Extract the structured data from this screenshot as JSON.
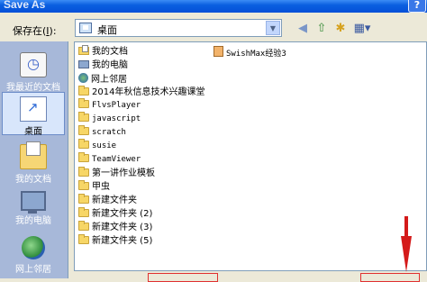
{
  "window": {
    "title": "Save As",
    "help_label": "?"
  },
  "save_in": {
    "label": "保存在(",
    "mnemonic": "I",
    "label_end": "):",
    "value": "桌面"
  },
  "places": [
    {
      "label": "我最近的文档",
      "icon": "recent-documents-icon"
    },
    {
      "label": "桌面",
      "icon": "desktop-icon"
    },
    {
      "label": "我的文档",
      "icon": "my-documents-icon"
    },
    {
      "label": "我的电脑",
      "icon": "my-computer-icon"
    },
    {
      "label": "网上邻居",
      "icon": "network-places-icon"
    }
  ],
  "files": [
    {
      "name": "我的文档",
      "icon": "my-documents-icon"
    },
    {
      "name": "我的电脑",
      "icon": "my-computer-icon"
    },
    {
      "name": "网上邻居",
      "icon": "network-icon"
    },
    {
      "name": "2014年秋信息技术兴趣课堂",
      "icon": "folder-icon"
    },
    {
      "name": "FlvsPlayer",
      "icon": "folder-icon"
    },
    {
      "name": "javascript",
      "icon": "folder-icon"
    },
    {
      "name": "scratch",
      "icon": "folder-icon"
    },
    {
      "name": "susie",
      "icon": "folder-icon"
    },
    {
      "name": "TeamViewer",
      "icon": "folder-icon"
    },
    {
      "name": "第一讲作业模板",
      "icon": "folder-icon"
    },
    {
      "name": "甲虫",
      "icon": "folder-icon"
    },
    {
      "name": "新建文件夹",
      "icon": "folder-icon"
    },
    {
      "name": "新建文件夹 (2)",
      "icon": "folder-icon"
    },
    {
      "name": "新建文件夹 (3)",
      "icon": "folder-icon"
    },
    {
      "name": "新建文件夹 (5)",
      "icon": "folder-icon"
    },
    {
      "name": "SwishMax经验3",
      "icon": "swishmax-file-icon"
    }
  ],
  "toolbar": {
    "back": "◀",
    "up": "⇧",
    "new_folder": "✱",
    "views": "▦▾"
  },
  "colors": {
    "title_bar": "#0550d8",
    "places_bar": "#a7b8d9",
    "highlight": "#d41a1a"
  }
}
